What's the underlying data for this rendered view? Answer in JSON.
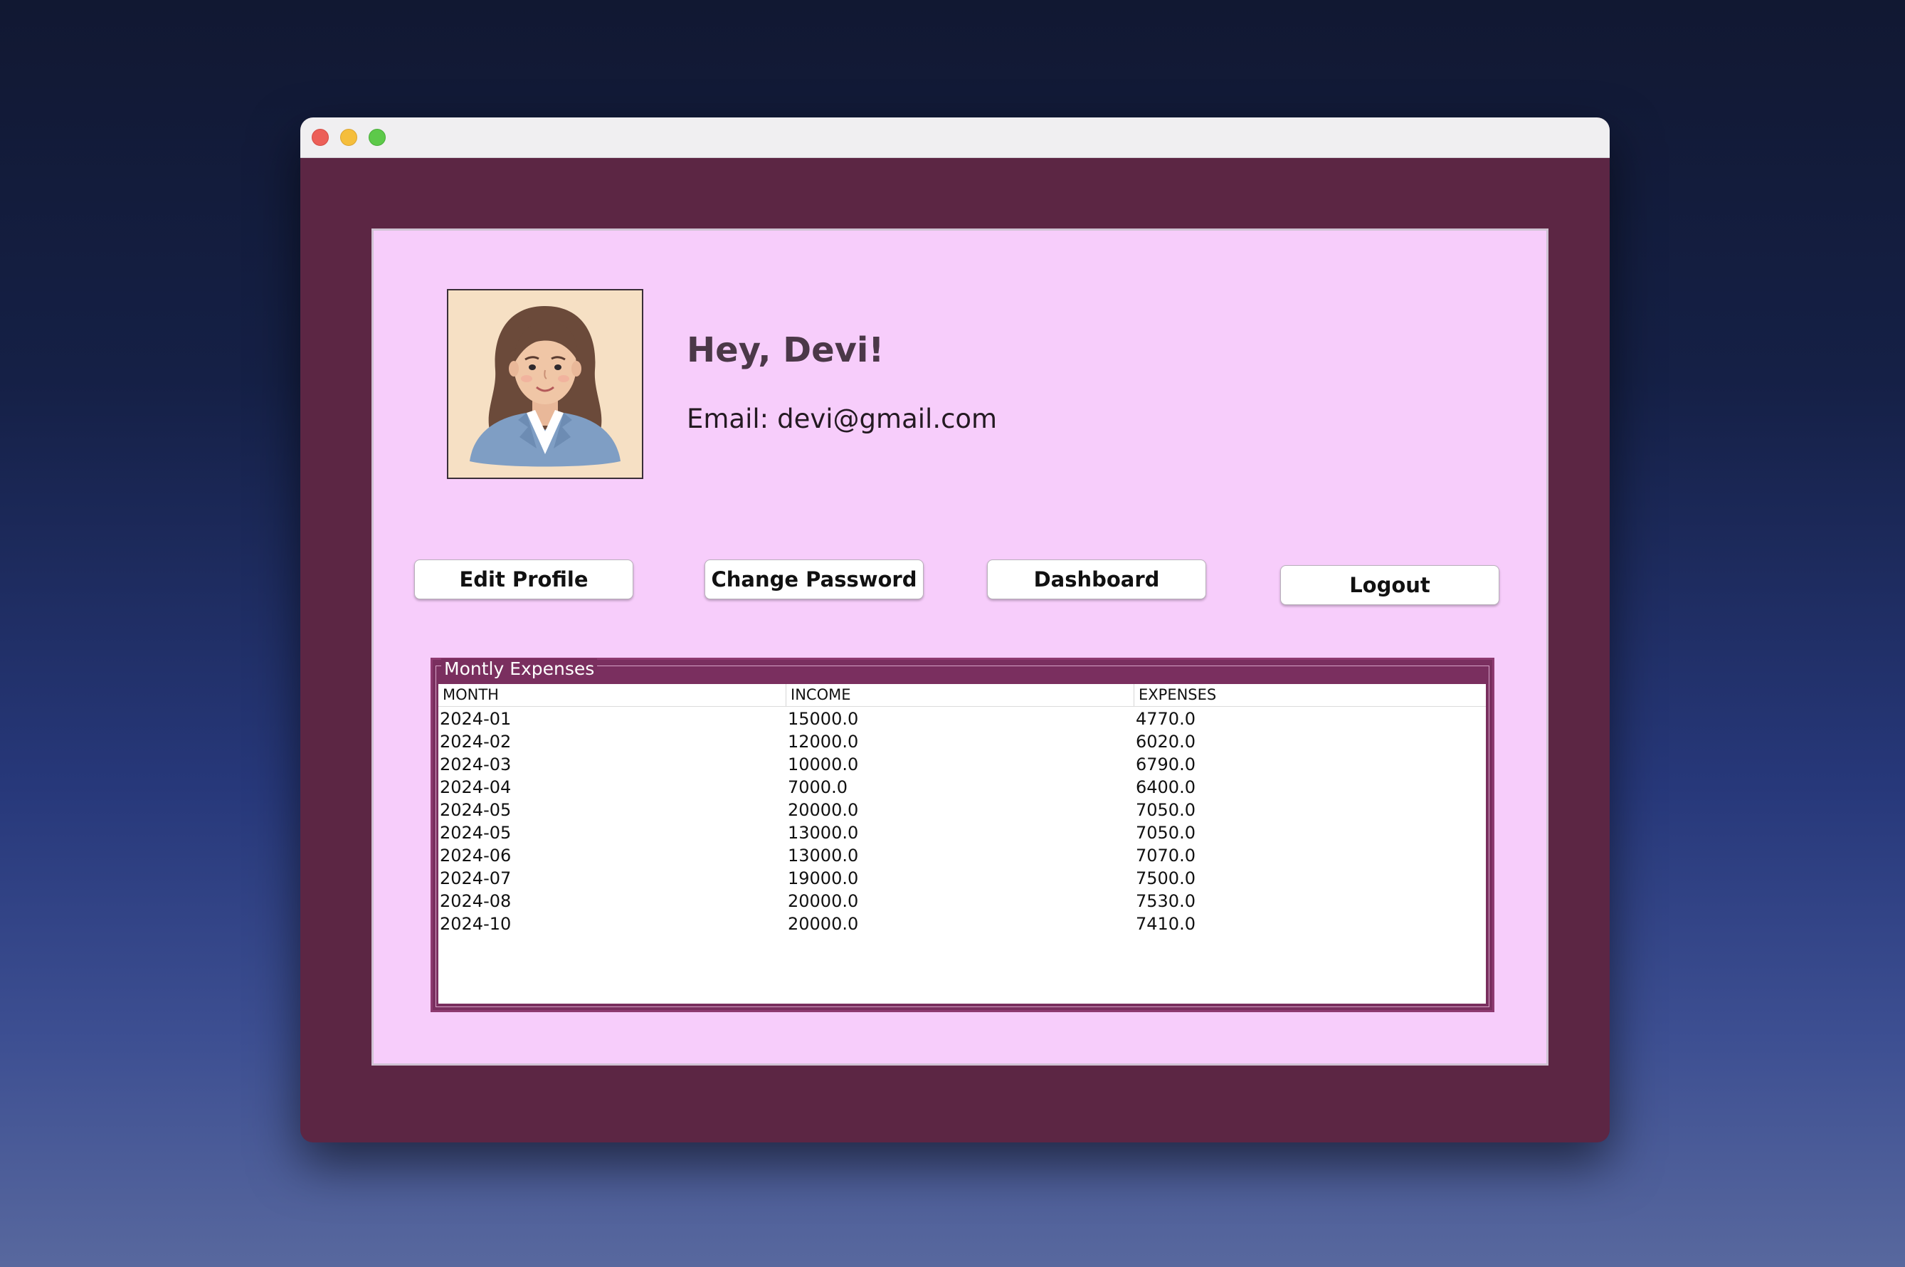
{
  "profile": {
    "greeting": "Hey, Devi!",
    "email_label": "Email:",
    "email_value": "devi@gmail.com"
  },
  "buttons": {
    "edit_profile": "Edit Profile",
    "change_password": "Change Password",
    "dashboard": "Dashboard",
    "logout": "Logout"
  },
  "expenses": {
    "title": "Montly Expenses",
    "columns": [
      "MONTH",
      "INCOME",
      "EXPENSES"
    ],
    "rows": [
      [
        "2024-01",
        "15000.0",
        "4770.0"
      ],
      [
        "2024-02",
        "12000.0",
        "6020.0"
      ],
      [
        "2024-03",
        "10000.0",
        "6790.0"
      ],
      [
        "2024-04",
        "7000.0",
        "6400.0"
      ],
      [
        "2024-05",
        "20000.0",
        "7050.0"
      ],
      [
        "2024-05",
        "13000.0",
        "7050.0"
      ],
      [
        "2024-06",
        "13000.0",
        "7070.0"
      ],
      [
        "2024-07",
        "19000.0",
        "7500.0"
      ],
      [
        "2024-08",
        "20000.0",
        "7530.0"
      ],
      [
        "2024-10",
        "20000.0",
        "7410.0"
      ]
    ]
  },
  "colors": {
    "window_background": "#5c2644",
    "panel_background": "#f7cdfb",
    "table_border": "#7a2f5f",
    "greeting_text": "#4b3848"
  },
  "icons": {
    "avatar": "woman-avatar-illustration"
  }
}
